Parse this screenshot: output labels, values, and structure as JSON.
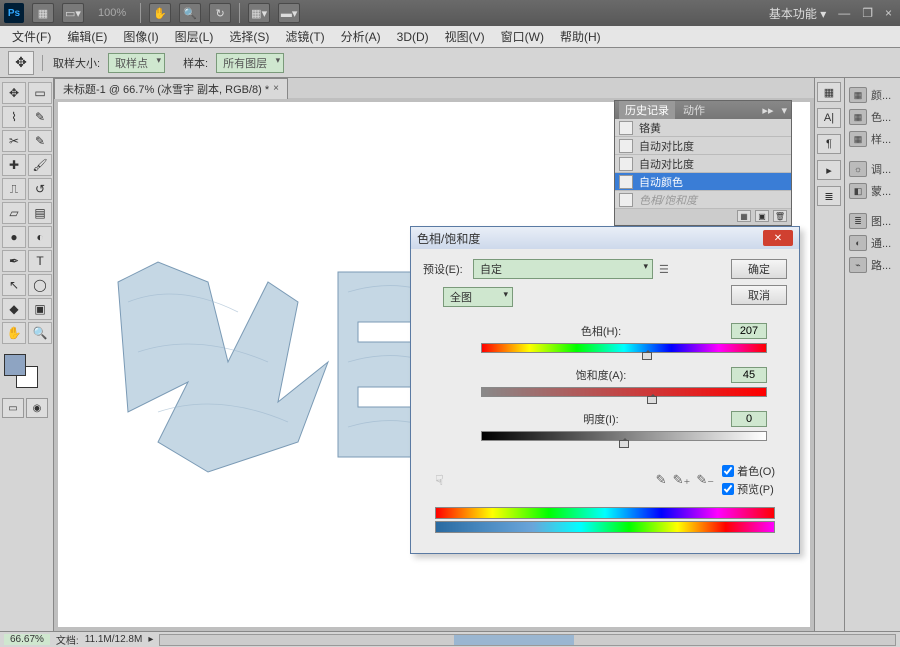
{
  "app": {
    "ps": "Ps"
  },
  "title_tools": {
    "zoom_readout": "100%"
  },
  "workspace": {
    "label": "基本功能 ▾"
  },
  "window": {
    "min": "—",
    "max": "❐",
    "close": "×"
  },
  "menu": {
    "file": "文件(F)",
    "edit": "编辑(E)",
    "image": "图像(I)",
    "layer": "图层(L)",
    "select": "选择(S)",
    "filter": "滤镜(T)",
    "analysis": "分析(A)",
    "3d": "3D(D)",
    "view": "视图(V)",
    "window": "窗口(W)",
    "help": "帮助(H)"
  },
  "options": {
    "sample_size_label": "取样大小:",
    "sample_size_value": "取样点",
    "sample_label": "样本:",
    "sample_value": "所有图层"
  },
  "doc_tab": {
    "name": "未标题-1 @ 66.7% (冰雪宇 副本, RGB/8) *",
    "close": "×"
  },
  "history": {
    "tab1": "历史记录",
    "tab2": "动作",
    "items": [
      {
        "label": "铬黄",
        "sel": false,
        "dim": false
      },
      {
        "label": "自动对比度",
        "sel": false,
        "dim": false
      },
      {
        "label": "自动对比度",
        "sel": false,
        "dim": false
      },
      {
        "label": "自动颜色",
        "sel": true,
        "dim": false
      },
      {
        "label": "色相/饱和度",
        "sel": false,
        "dim": true
      }
    ]
  },
  "dialog": {
    "title": "色相/饱和度",
    "preset_label": "预设(E):",
    "preset_value": "自定",
    "channel_value": "全图",
    "ok": "确定",
    "cancel": "取消",
    "hue_label": "色相(H):",
    "hue_value": "207",
    "sat_label": "饱和度(A):",
    "sat_value": "45",
    "light_label": "明度(I):",
    "light_value": "0",
    "colorize": "着色(O)",
    "preview": "预览(P)"
  },
  "right_panels": {
    "p1": "颜...",
    "p2": "色...",
    "p3": "样...",
    "p4": "调...",
    "p5": "蒙...",
    "p6": "图...",
    "p7": "通...",
    "p8": "路..."
  },
  "status": {
    "zoom": "66.67%",
    "doc_label": "文档:",
    "doc_size": "11.1M/12.8M"
  }
}
